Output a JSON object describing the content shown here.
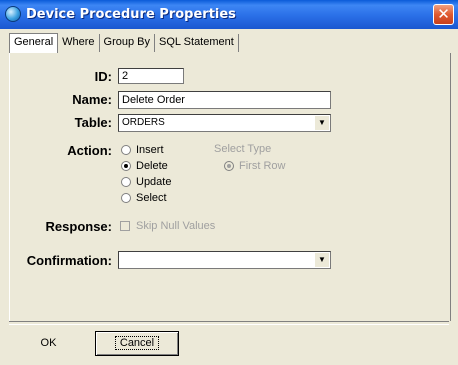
{
  "window": {
    "title": "Device Procedure Properties",
    "close_symbol": "✕"
  },
  "tabs": [
    {
      "label": "General",
      "active": true
    },
    {
      "label": "Where",
      "active": false
    },
    {
      "label": "Group By",
      "active": false
    },
    {
      "label": "SQL Statement",
      "active": false
    }
  ],
  "form": {
    "id_label": "ID:",
    "id_value": "2",
    "name_label": "Name:",
    "name_value": "Delete Order",
    "table_label": "Table:",
    "table_value": "ORDERS",
    "action_label": "Action:",
    "actions": [
      {
        "label": "Insert",
        "selected": false
      },
      {
        "label": "Delete",
        "selected": true
      },
      {
        "label": "Update",
        "selected": false
      },
      {
        "label": "Select",
        "selected": false
      }
    ],
    "select_type_label": "Select Type",
    "select_type_option": "First Row",
    "response_label": "Response:",
    "skip_null_label": "Skip Null Values",
    "confirmation_label": "Confirmation:",
    "confirmation_value": ""
  },
  "buttons": {
    "ok": "OK",
    "cancel": "Cancel"
  },
  "icons": {
    "app": "app-icon",
    "dropdown": "▼"
  }
}
